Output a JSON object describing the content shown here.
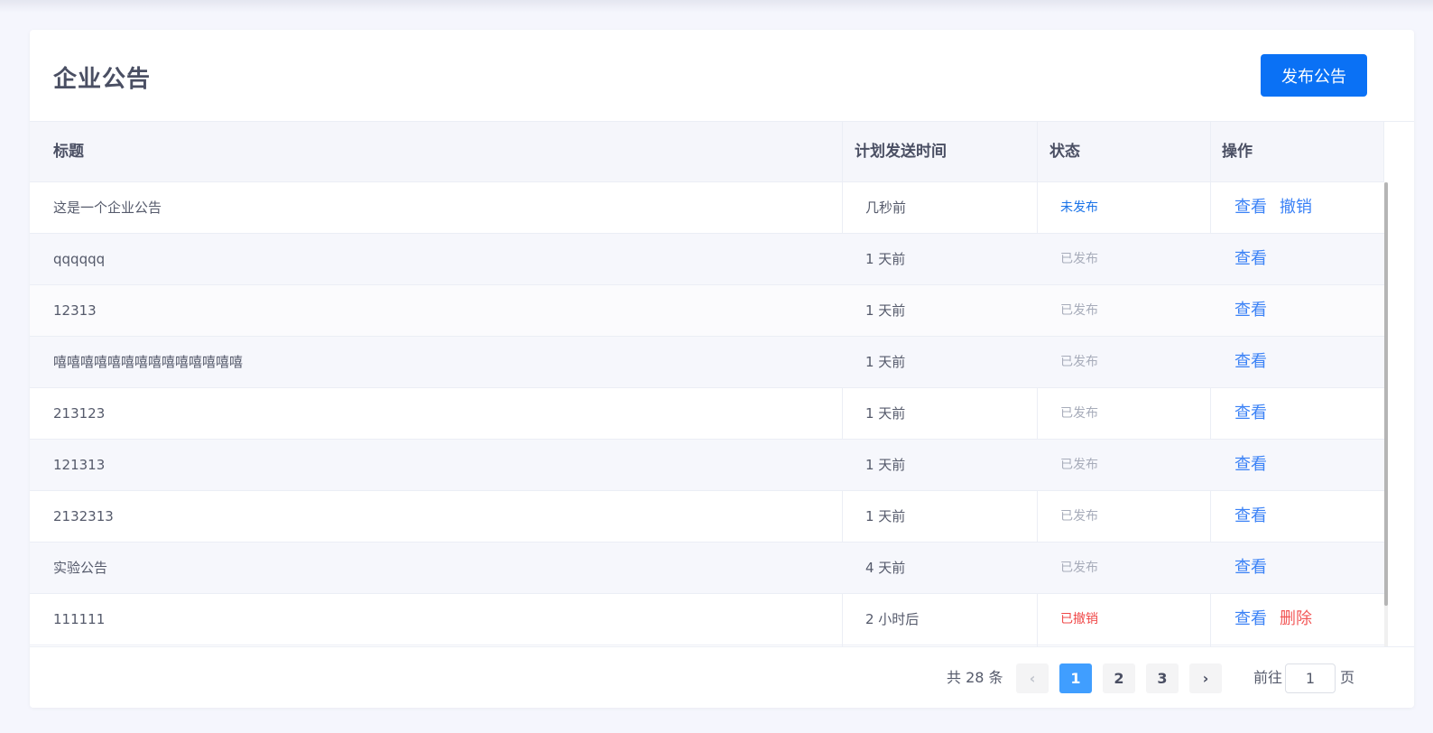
{
  "header": {
    "title": "企业公告",
    "publish_button": "发布公告"
  },
  "table": {
    "columns": [
      "标题",
      "计划发送时间",
      "状态",
      "操作"
    ],
    "rows": [
      {
        "title": "这是一个企业公告",
        "time": "几秒前",
        "status": "未发布",
        "actions": [
          "查看",
          "撤销"
        ]
      },
      {
        "title": "qqqqqq",
        "time": "1 天前",
        "status": "已发布",
        "actions": [
          "查看"
        ]
      },
      {
        "title": "12313",
        "time": "1 天前",
        "status": "已发布",
        "actions": [
          "查看"
        ]
      },
      {
        "title": "嘻嘻嘻嘻嘻嘻嘻嘻嘻嘻嘻嘻嘻嘻",
        "time": "1 天前",
        "status": "已发布",
        "actions": [
          "查看"
        ]
      },
      {
        "title": "213123",
        "time": "1 天前",
        "status": "已发布",
        "actions": [
          "查看"
        ]
      },
      {
        "title": "121313",
        "time": "1 天前",
        "status": "已发布",
        "actions": [
          "查看"
        ]
      },
      {
        "title": "2132313",
        "time": "1 天前",
        "status": "已发布",
        "actions": [
          "查看"
        ]
      },
      {
        "title": "实验公告",
        "time": "4 天前",
        "status": "已发布",
        "actions": [
          "查看"
        ]
      },
      {
        "title": "111111",
        "time": "2 小时后",
        "status": "已撤销",
        "actions": [
          "查看",
          "删除"
        ]
      }
    ]
  },
  "pagination": {
    "total_text": "共 28 条",
    "prev_icon": "‹",
    "next_icon": "›",
    "pages": [
      "1",
      "2",
      "3"
    ],
    "current_page": "1",
    "goto_prefix": "前往",
    "goto_value": "1",
    "goto_suffix": "页"
  },
  "colors": {
    "primary": "#0a71f5",
    "unpublished": "#1a73e8",
    "published": "#a7acba",
    "revoked": "#f04848"
  }
}
